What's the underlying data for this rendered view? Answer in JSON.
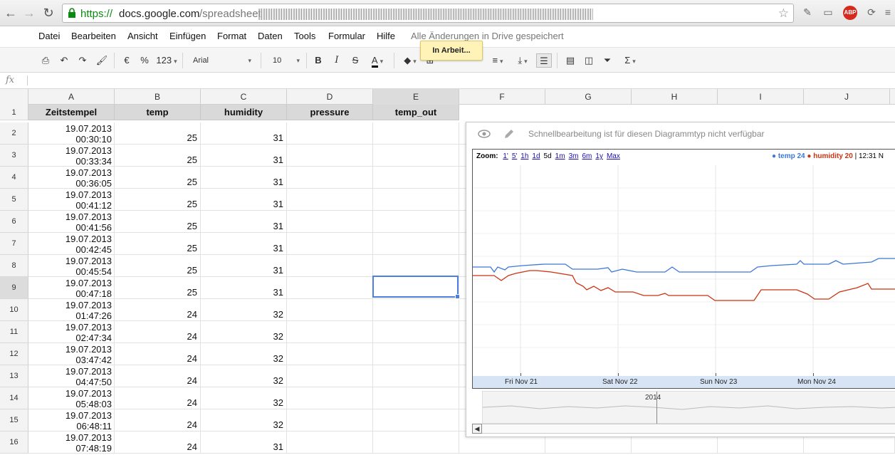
{
  "browser": {
    "url_scheme": "https://",
    "url_host": "docs.google.com",
    "url_path": "/spreadsheet",
    "extension_abp": "ABP"
  },
  "menu": {
    "items": [
      "Datei",
      "Bearbeiten",
      "Ansicht",
      "Einfügen",
      "Format",
      "Daten",
      "Tools",
      "Formular",
      "Hilfe"
    ],
    "save_status": "Alle Änderungen in Drive gespeichert"
  },
  "toolbar": {
    "currency": "€",
    "percent": "%",
    "number_format": "123",
    "font": "Arial",
    "font_size": "10",
    "bold": "B",
    "italic": "I",
    "strike": "S",
    "text_color": "A",
    "tooltip": "In Arbeit..."
  },
  "formula_bar": {
    "fx": "fx",
    "value": ""
  },
  "sheet": {
    "columns": [
      "A",
      "B",
      "C",
      "D",
      "E",
      "F",
      "G",
      "H",
      "I",
      "J"
    ],
    "selected_column": "E",
    "selected_row": "9",
    "headers": [
      "Zeitstempel",
      "temp",
      "humidity",
      "pressure",
      "temp_out"
    ],
    "rows": [
      {
        "n": "1"
      },
      {
        "n": "2",
        "date": "19.07.2013",
        "time": "00:30:10",
        "temp": "25",
        "humidity": "31"
      },
      {
        "n": "3",
        "date": "19.07.2013",
        "time": "00:33:34",
        "temp": "25",
        "humidity": "31"
      },
      {
        "n": "4",
        "date": "19.07.2013",
        "time": "00:36:05",
        "temp": "25",
        "humidity": "31"
      },
      {
        "n": "5",
        "date": "19.07.2013",
        "time": "00:41:12",
        "temp": "25",
        "humidity": "31"
      },
      {
        "n": "6",
        "date": "19.07.2013",
        "time": "00:41:56",
        "temp": "25",
        "humidity": "31"
      },
      {
        "n": "7",
        "date": "19.07.2013",
        "time": "00:42:45",
        "temp": "25",
        "humidity": "31"
      },
      {
        "n": "8",
        "date": "19.07.2013",
        "time": "00:45:54",
        "temp": "25",
        "humidity": "31"
      },
      {
        "n": "9",
        "date": "19.07.2013",
        "time": "00:47:18",
        "temp": "25",
        "humidity": "31"
      },
      {
        "n": "10",
        "date": "19.07.2013",
        "time": "01:47:26",
        "temp": "24",
        "humidity": "32"
      },
      {
        "n": "11",
        "date": "19.07.2013",
        "time": "02:47:34",
        "temp": "24",
        "humidity": "32"
      },
      {
        "n": "12",
        "date": "19.07.2013",
        "time": "03:47:42",
        "temp": "24",
        "humidity": "32"
      },
      {
        "n": "13",
        "date": "19.07.2013",
        "time": "04:47:50",
        "temp": "24",
        "humidity": "32"
      },
      {
        "n": "14",
        "date": "19.07.2013",
        "time": "05:48:03",
        "temp": "24",
        "humidity": "32"
      },
      {
        "n": "15",
        "date": "19.07.2013",
        "time": "06:48:11",
        "temp": "24",
        "humidity": "32"
      },
      {
        "n": "16",
        "date": "19.07.2013",
        "time": "07:48:19",
        "temp": "24",
        "humidity": "31"
      }
    ]
  },
  "chart": {
    "quick_edit_msg": "Schnellbearbeitung ist für diesen Diagrammtyp nicht verfügbar",
    "zoom_label": "Zoom:",
    "zoom_options": [
      "1'",
      "5'",
      "1h",
      "1d",
      "5d",
      "1m",
      "3m",
      "6m",
      "1y",
      "Max"
    ],
    "zoom_active": "5d",
    "legend_temp": "● temp 24",
    "legend_humidity": "● humidity 20",
    "legend_time": "| 12:31 N",
    "x_labels": [
      "Fri Nov 21",
      "Sat Nov 22",
      "Sun Nov 23",
      "Mon Nov 24"
    ],
    "range_label": "2014",
    "scroll_left": "◀",
    "colors": {
      "temp": "#3c78d8",
      "humidity": "#cc3311"
    }
  },
  "chart_data": {
    "type": "line",
    "x": [
      "Fri Nov 21",
      "Sat Nov 22",
      "Sun Nov 23",
      "Mon Nov 24"
    ],
    "series": [
      {
        "name": "temp",
        "values": [
          24,
          24,
          24,
          24
        ]
      },
      {
        "name": "humidity",
        "values": [
          20,
          20,
          20,
          20
        ]
      }
    ]
  }
}
